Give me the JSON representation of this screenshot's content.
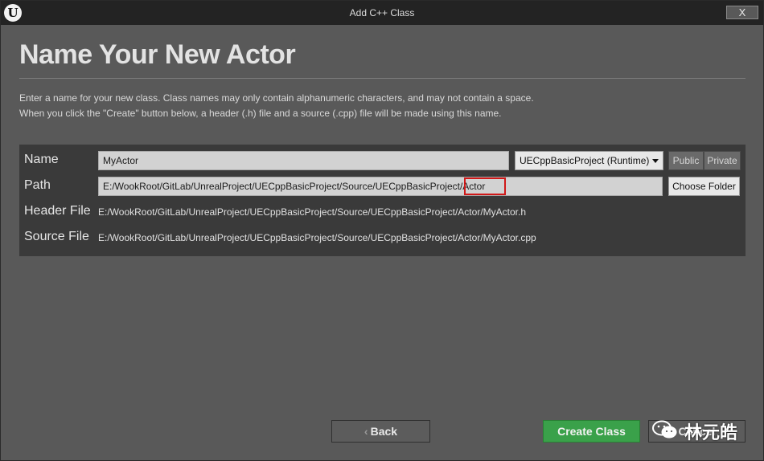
{
  "window": {
    "title": "Add C++ Class",
    "close_label": "X",
    "logo_letter": "U"
  },
  "header": {
    "title": "Name Your New Actor",
    "description_line1": "Enter a name for your new class. Class names may only contain alphanumeric characters, and may not contain a space.",
    "description_line2": "When you click the \"Create\" button below, a header (.h) file and a source (.cpp) file will be made using this name."
  },
  "form": {
    "name_label": "Name",
    "name_value": "MyActor",
    "module_selected": "UECppBasicProject (Runtime)",
    "visibility_options": [
      "Public",
      "Private"
    ],
    "path_label": "Path",
    "path_value": "E:/WookRoot/GitLab/UnrealProject/UECppBasicProject/Source/UECppBasicProject/Actor",
    "choose_folder_label": "Choose Folder",
    "header_file_label": "Header File",
    "header_file_value": "E:/WookRoot/GitLab/UnrealProject/UECppBasicProject/Source/UECppBasicProject/Actor/MyActor.h",
    "source_file_label": "Source File",
    "source_file_value": "E:/WookRoot/GitLab/UnrealProject/UECppBasicProject/Source/UECppBasicProject/Actor/MyActor.cpp"
  },
  "footer": {
    "back_label": "Back",
    "back_chevron": "‹",
    "create_label": "Create Class",
    "cancel_label": "Cancel"
  },
  "watermark": {
    "text": "林元皓",
    "icon": "wechat-icon"
  },
  "colors": {
    "create_button": "#3aa14a",
    "highlight_box": "#d01818"
  }
}
